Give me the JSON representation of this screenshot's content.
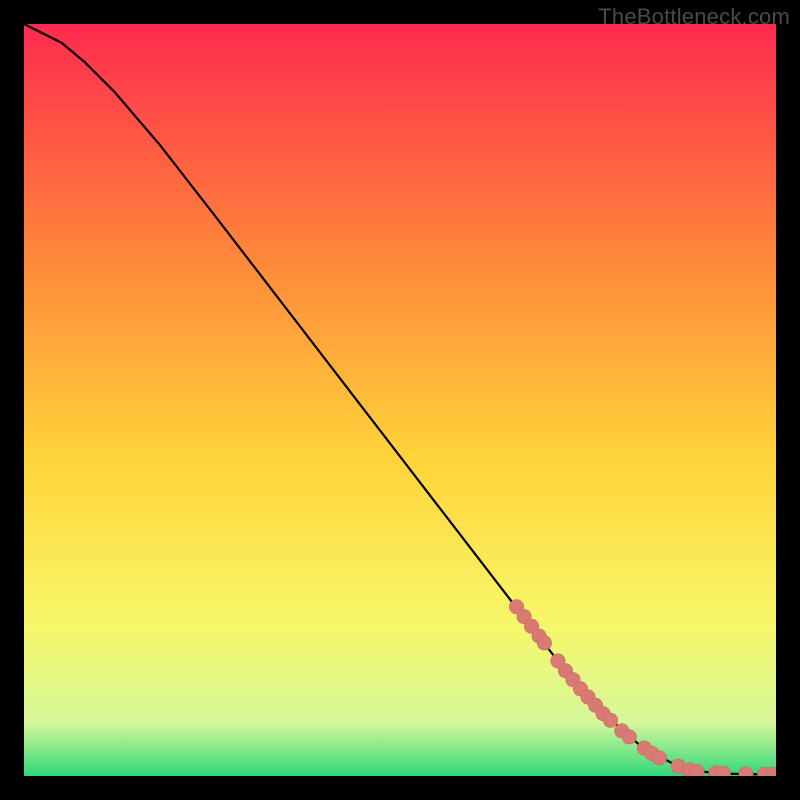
{
  "watermark": "TheBottleneck.com",
  "colors": {
    "background": "#000000",
    "curve": "#000000",
    "marker_fill": "#d97a74",
    "marker_stroke": "#c96a64",
    "gradient_top": "#ff2a4f",
    "gradient_mid1": "#ff8a3a",
    "gradient_mid2": "#ffd43a",
    "gradient_mid3": "#f7f76a",
    "gradient_mid4": "#d4f79a",
    "gradient_bottom": "#2fd87a"
  },
  "chart_data": {
    "type": "line",
    "title": "",
    "xlabel": "",
    "ylabel": "",
    "xlim": [
      0,
      100
    ],
    "ylim": [
      0,
      100
    ],
    "grid": false,
    "legend": false,
    "series": [
      {
        "name": "curve",
        "x": [
          0,
          2,
          5,
          8,
          12,
          18,
          25,
          35,
          45,
          55,
          65,
          72,
          78,
          82,
          86,
          88,
          90,
          92,
          94,
          96,
          98,
          100
        ],
        "y": [
          100,
          99,
          97.5,
          95,
          91,
          84,
          75,
          62,
          49,
          36,
          23,
          14,
          7.5,
          4,
          1.8,
          1.0,
          0.6,
          0.4,
          0.3,
          0.25,
          0.22,
          0.2
        ]
      }
    ],
    "markers": [
      {
        "x": 65.5,
        "y": 22.5
      },
      {
        "x": 66.5,
        "y": 21.2
      },
      {
        "x": 67.5,
        "y": 19.9
      },
      {
        "x": 68.5,
        "y": 18.6
      },
      {
        "x": 69.2,
        "y": 17.7
      },
      {
        "x": 71.0,
        "y": 15.3
      },
      {
        "x": 72.0,
        "y": 14.0
      },
      {
        "x": 73.0,
        "y": 12.8
      },
      {
        "x": 74.0,
        "y": 11.6
      },
      {
        "x": 75.0,
        "y": 10.5
      },
      {
        "x": 76.0,
        "y": 9.4
      },
      {
        "x": 77.0,
        "y": 8.3
      },
      {
        "x": 78.0,
        "y": 7.4
      },
      {
        "x": 79.5,
        "y": 6.0
      },
      {
        "x": 80.5,
        "y": 5.2
      },
      {
        "x": 82.5,
        "y": 3.7
      },
      {
        "x": 83.5,
        "y": 3.0
      },
      {
        "x": 84.5,
        "y": 2.4
      },
      {
        "x": 87.0,
        "y": 1.3
      },
      {
        "x": 88.5,
        "y": 0.8
      },
      {
        "x": 89.5,
        "y": 0.6
      },
      {
        "x": 92.0,
        "y": 0.4
      },
      {
        "x": 93.0,
        "y": 0.35
      },
      {
        "x": 96.0,
        "y": 0.27
      },
      {
        "x": 98.5,
        "y": 0.22
      },
      {
        "x": 99.5,
        "y": 0.21
      }
    ]
  }
}
